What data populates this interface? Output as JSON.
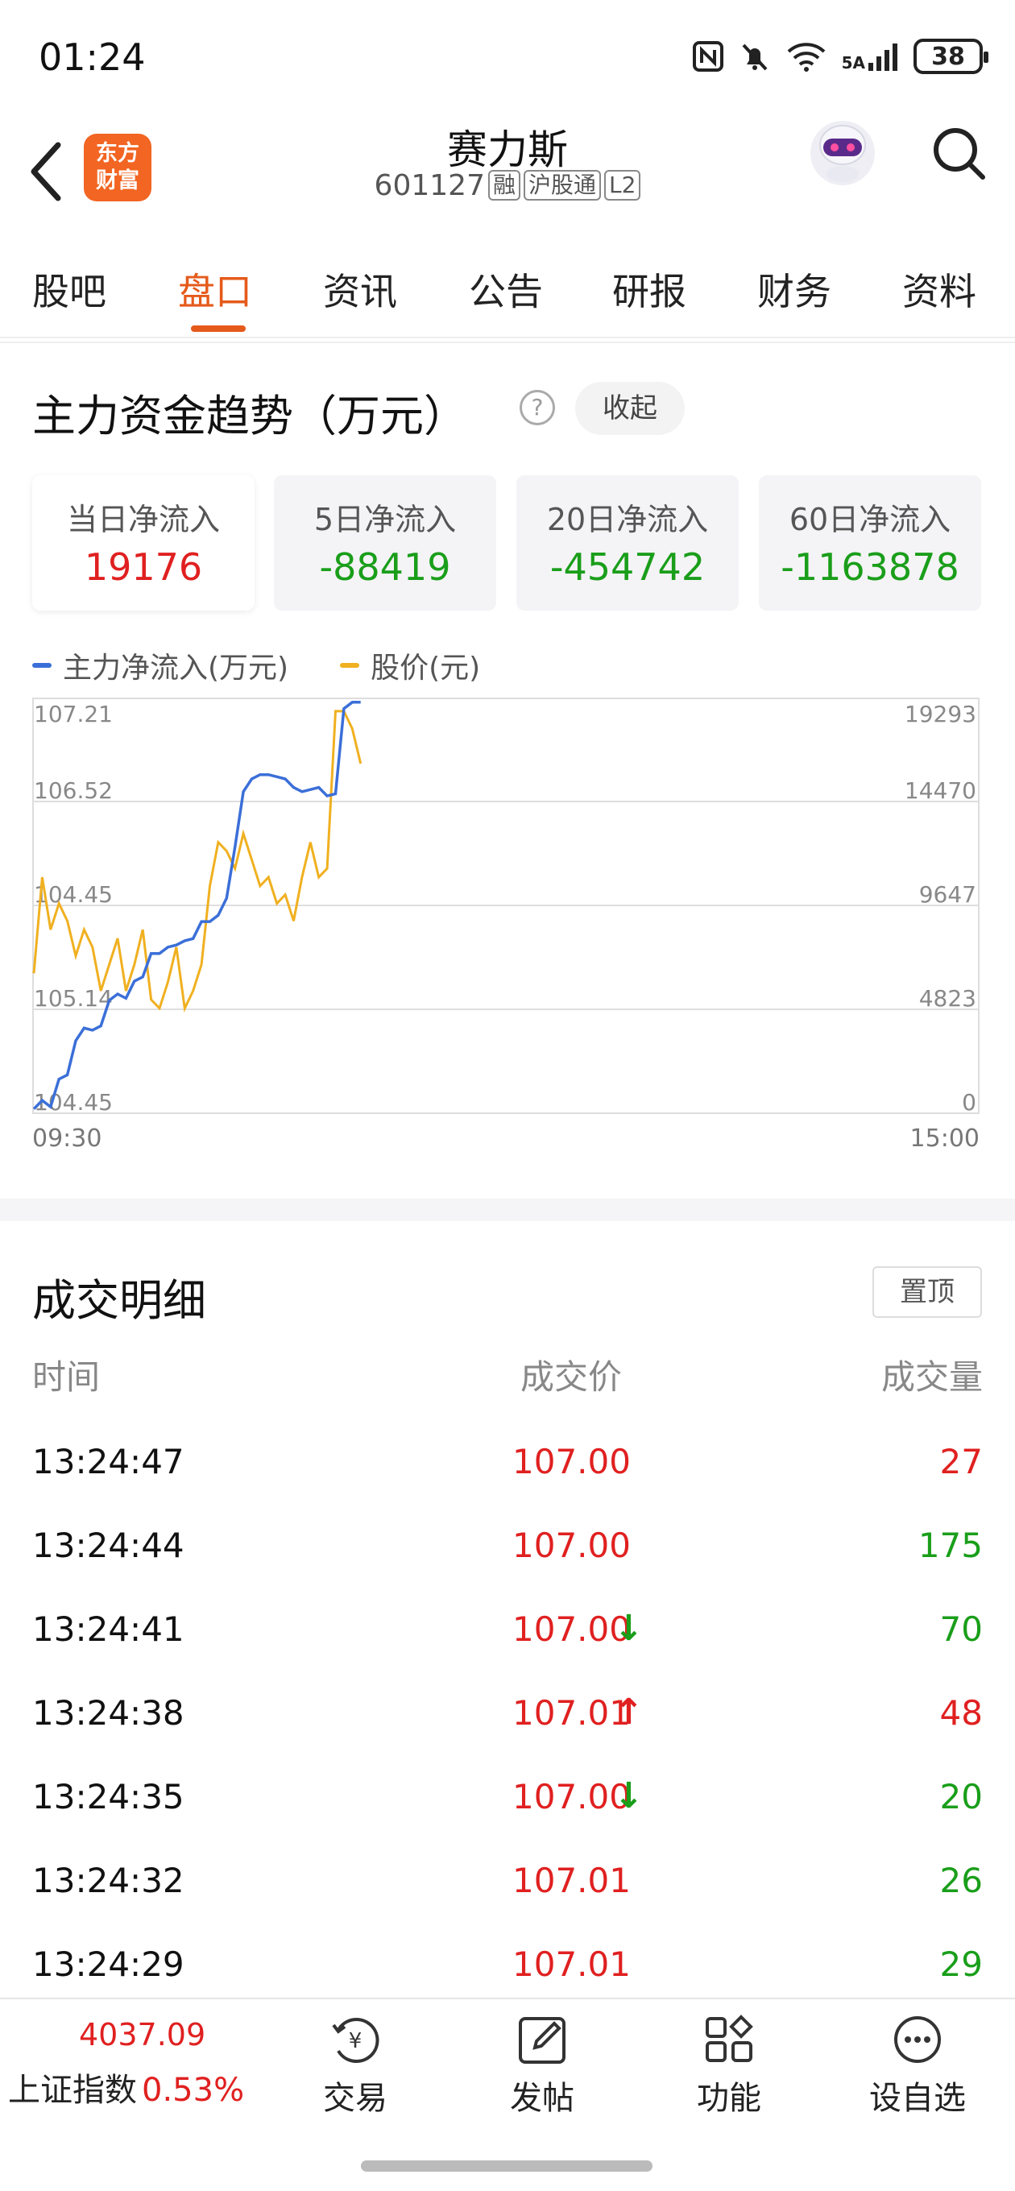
{
  "status_bar": {
    "time": "01:24",
    "battery": "38",
    "signal_label": "5A"
  },
  "header": {
    "stock_name": "赛力斯",
    "stock_code": "601127",
    "tags": [
      "融",
      "沪股通",
      "L2"
    ],
    "logo_text_1": "东方",
    "logo_text_2": "财富"
  },
  "tabs": [
    "股吧",
    "盘口",
    "资讯",
    "公告",
    "研报",
    "财务",
    "资料"
  ],
  "active_tab": "盘口",
  "fund_trend": {
    "title": "主力资金趋势（万元）",
    "help": "?",
    "collapse_label": "收起",
    "cards": [
      {
        "label": "当日净流入",
        "value": "19176",
        "color": "red"
      },
      {
        "label": "5日净流入",
        "value": "-88419",
        "color": "green"
      },
      {
        "label": "20日净流入",
        "value": "-454742",
        "color": "green"
      },
      {
        "label": "60日净流入",
        "value": "-1163878",
        "color": "green"
      }
    ],
    "legend": [
      "主力净流入(万元)",
      "股价(元)"
    ],
    "time_start": "09:30",
    "time_end": "15:00"
  },
  "chart_data": {
    "type": "line",
    "x_range": [
      "09:30",
      "15:00"
    ],
    "left_axis": {
      "label": "股价(元)",
      "ticks": [
        "107.21",
        "106.52",
        "104.45",
        "105.14",
        "104.45"
      ]
    },
    "right_axis": {
      "label": "主力净流入(万元)",
      "ticks": [
        "19293",
        "14470",
        "9647",
        "4823",
        "0"
      ]
    },
    "grid": true,
    "legend_position": "top-left",
    "colors": {
      "net_inflow": "#3b6fd8",
      "price": "#f0b020"
    },
    "series": [
      {
        "name": "主力净流入(万元)",
        "axis": "right",
        "values": [
          200,
          600,
          300,
          1600,
          1800,
          3400,
          4000,
          3900,
          4100,
          5300,
          5600,
          5400,
          6200,
          6400,
          7500,
          7500,
          7800,
          7900,
          8100,
          8200,
          9000,
          9000,
          9300,
          10100,
          12500,
          15100,
          15700,
          15900,
          15900,
          15800,
          15700,
          15300,
          15100,
          15200,
          15300,
          14900,
          15000,
          19000,
          19300,
          19300
        ]
      },
      {
        "name": "股价(元)",
        "axis": "left",
        "values": [
          105.8,
          106.35,
          106.05,
          106.2,
          106.1,
          105.9,
          106.05,
          105.95,
          105.7,
          105.85,
          106.0,
          105.7,
          105.85,
          106.05,
          105.65,
          105.6,
          105.75,
          105.95,
          105.6,
          105.7,
          105.85,
          106.3,
          106.55,
          106.5,
          106.4,
          106.6,
          106.45,
          106.3,
          106.35,
          106.2,
          106.25,
          106.1,
          106.35,
          106.55,
          106.35,
          106.4,
          107.3,
          107.3,
          107.2,
          107.0
        ]
      }
    ]
  },
  "trades": {
    "title": "成交明细",
    "pin_label": "置顶",
    "columns": [
      "时间",
      "成交价",
      "成交量"
    ],
    "rows": [
      {
        "time": "13:24:47",
        "price": "107.00",
        "arrow": "",
        "volume": "27",
        "vol_color": "red"
      },
      {
        "time": "13:24:44",
        "price": "107.00",
        "arrow": "",
        "volume": "175",
        "vol_color": "green"
      },
      {
        "time": "13:24:41",
        "price": "107.00",
        "arrow": "↓",
        "volume": "70",
        "vol_color": "green"
      },
      {
        "time": "13:24:38",
        "price": "107.01",
        "arrow": "↑",
        "volume": "48",
        "vol_color": "red"
      },
      {
        "time": "13:24:35",
        "price": "107.00",
        "arrow": "↓",
        "volume": "20",
        "vol_color": "green"
      },
      {
        "time": "13:24:32",
        "price": "107.01",
        "arrow": "",
        "volume": "26",
        "vol_color": "green"
      },
      {
        "time": "13:24:29",
        "price": "107.01",
        "arrow": "",
        "volume": "29",
        "vol_color": "green"
      }
    ]
  },
  "bottom_bar": {
    "index_value": "4037.09",
    "index_name": "上证指数",
    "index_change": "0.53%",
    "nav": [
      "交易",
      "发帖",
      "功能",
      "设自选"
    ]
  }
}
